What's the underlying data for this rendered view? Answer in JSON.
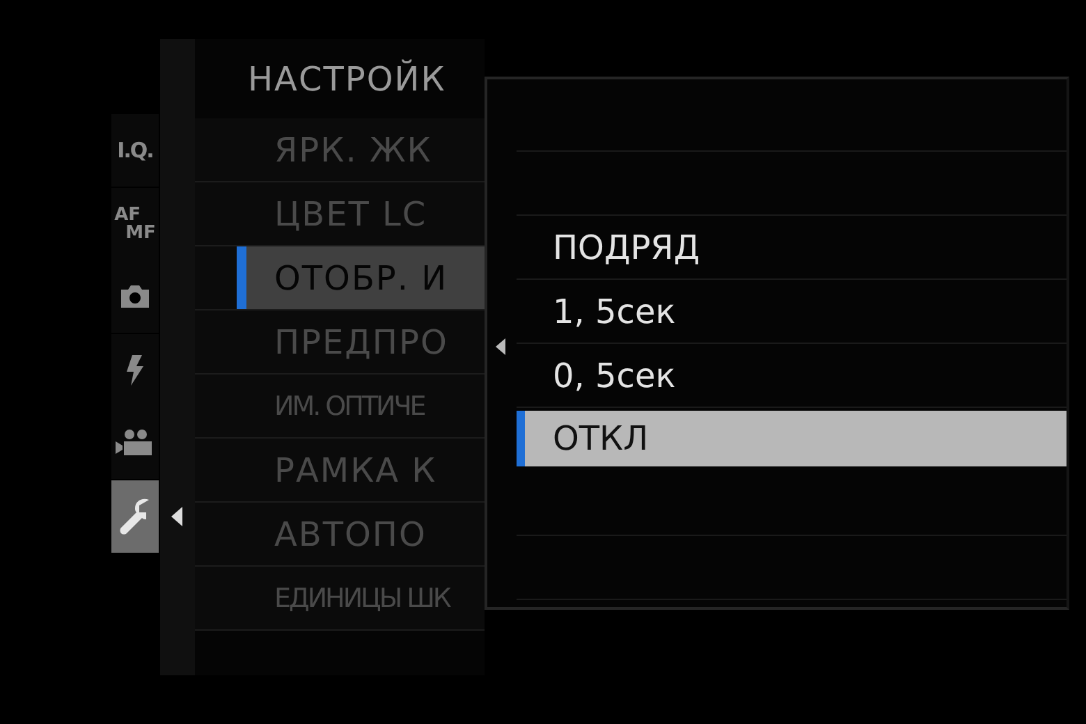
{
  "tabs": [
    {
      "kind": "text",
      "label": "I.Q.",
      "selected": false
    },
    {
      "kind": "stack",
      "label": "AF",
      "label_2": "MF",
      "selected": false
    },
    {
      "kind": "camera",
      "selected": false
    },
    {
      "kind": "flash",
      "selected": false
    },
    {
      "kind": "movie",
      "selected": false
    },
    {
      "kind": "wrench",
      "selected": true
    }
  ],
  "menu": {
    "title": "НАСТРОЙК",
    "items": [
      {
        "label": "ЯРК. ЖК",
        "narrow": false,
        "selected": false
      },
      {
        "label": "ЦВЕТ LC",
        "narrow": false,
        "selected": false
      },
      {
        "label": "ОТОБР. И",
        "narrow": false,
        "selected": true
      },
      {
        "label": "ПРЕДПРО",
        "narrow": false,
        "selected": false
      },
      {
        "label": "ИМ. ОПТИЧЕ",
        "narrow": true,
        "selected": false
      },
      {
        "label": "РАМКА К",
        "narrow": false,
        "selected": false
      },
      {
        "label": "АВТОПО",
        "narrow": false,
        "selected": false
      },
      {
        "label": "ЕДИНИЦЫ ШК",
        "narrow": true,
        "selected": false
      }
    ]
  },
  "options": [
    {
      "label": "ПОДРЯД",
      "selected": false
    },
    {
      "label": "1, 5сек",
      "selected": false
    },
    {
      "label": "0, 5сек",
      "selected": false
    },
    {
      "label": "ОТКЛ",
      "selected": true
    }
  ]
}
